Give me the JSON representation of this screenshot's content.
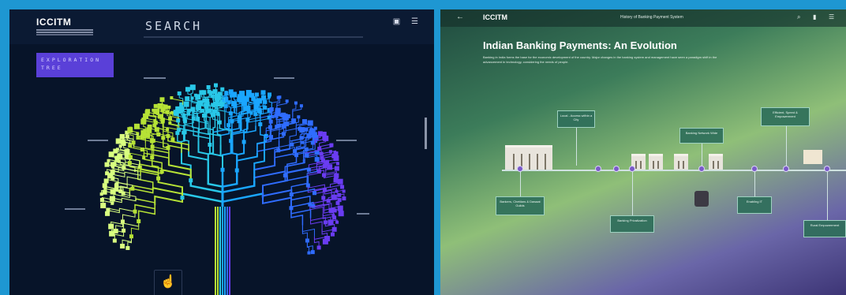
{
  "left": {
    "logo": "ICCITM",
    "search_label": "SEARCH",
    "exploration_tag": "EXPLORATION TREE",
    "icons": {
      "top_left": "grid-icon",
      "top_right": "menu-icon",
      "bottom": "hand-pointer-icon"
    },
    "tree_colors": [
      "#d9ff80",
      "#b6e236",
      "#29c8e8",
      "#1aa6ff",
      "#2f6cff",
      "#6a3cf2"
    ]
  },
  "right": {
    "logo": "ICCITM",
    "header_title": "History of Banking Payment System",
    "heading": "Indian Banking Payments: An Evolution",
    "description": "Banking in India forms the base for the economic development of the country. Major changes in the banking system and management have seen a paradigm shift in the advancement in technology, considering the needs of people.",
    "timeline_labels": {
      "l1": "Bankers, Chettiars & Dawaat Guilds",
      "l2": "Local - Access within a City",
      "l3": "Banking Privatization",
      "l4": "Banking Network Wide",
      "l5": "Enabling IT",
      "l6": "Efficient, Speed & Empowerment",
      "l7": "Rural Empowerment"
    },
    "icons": {
      "back": "back-arrow-icon",
      "search": "search-icon",
      "bookmark": "bookmark-icon",
      "menu": "menu-icon"
    }
  }
}
